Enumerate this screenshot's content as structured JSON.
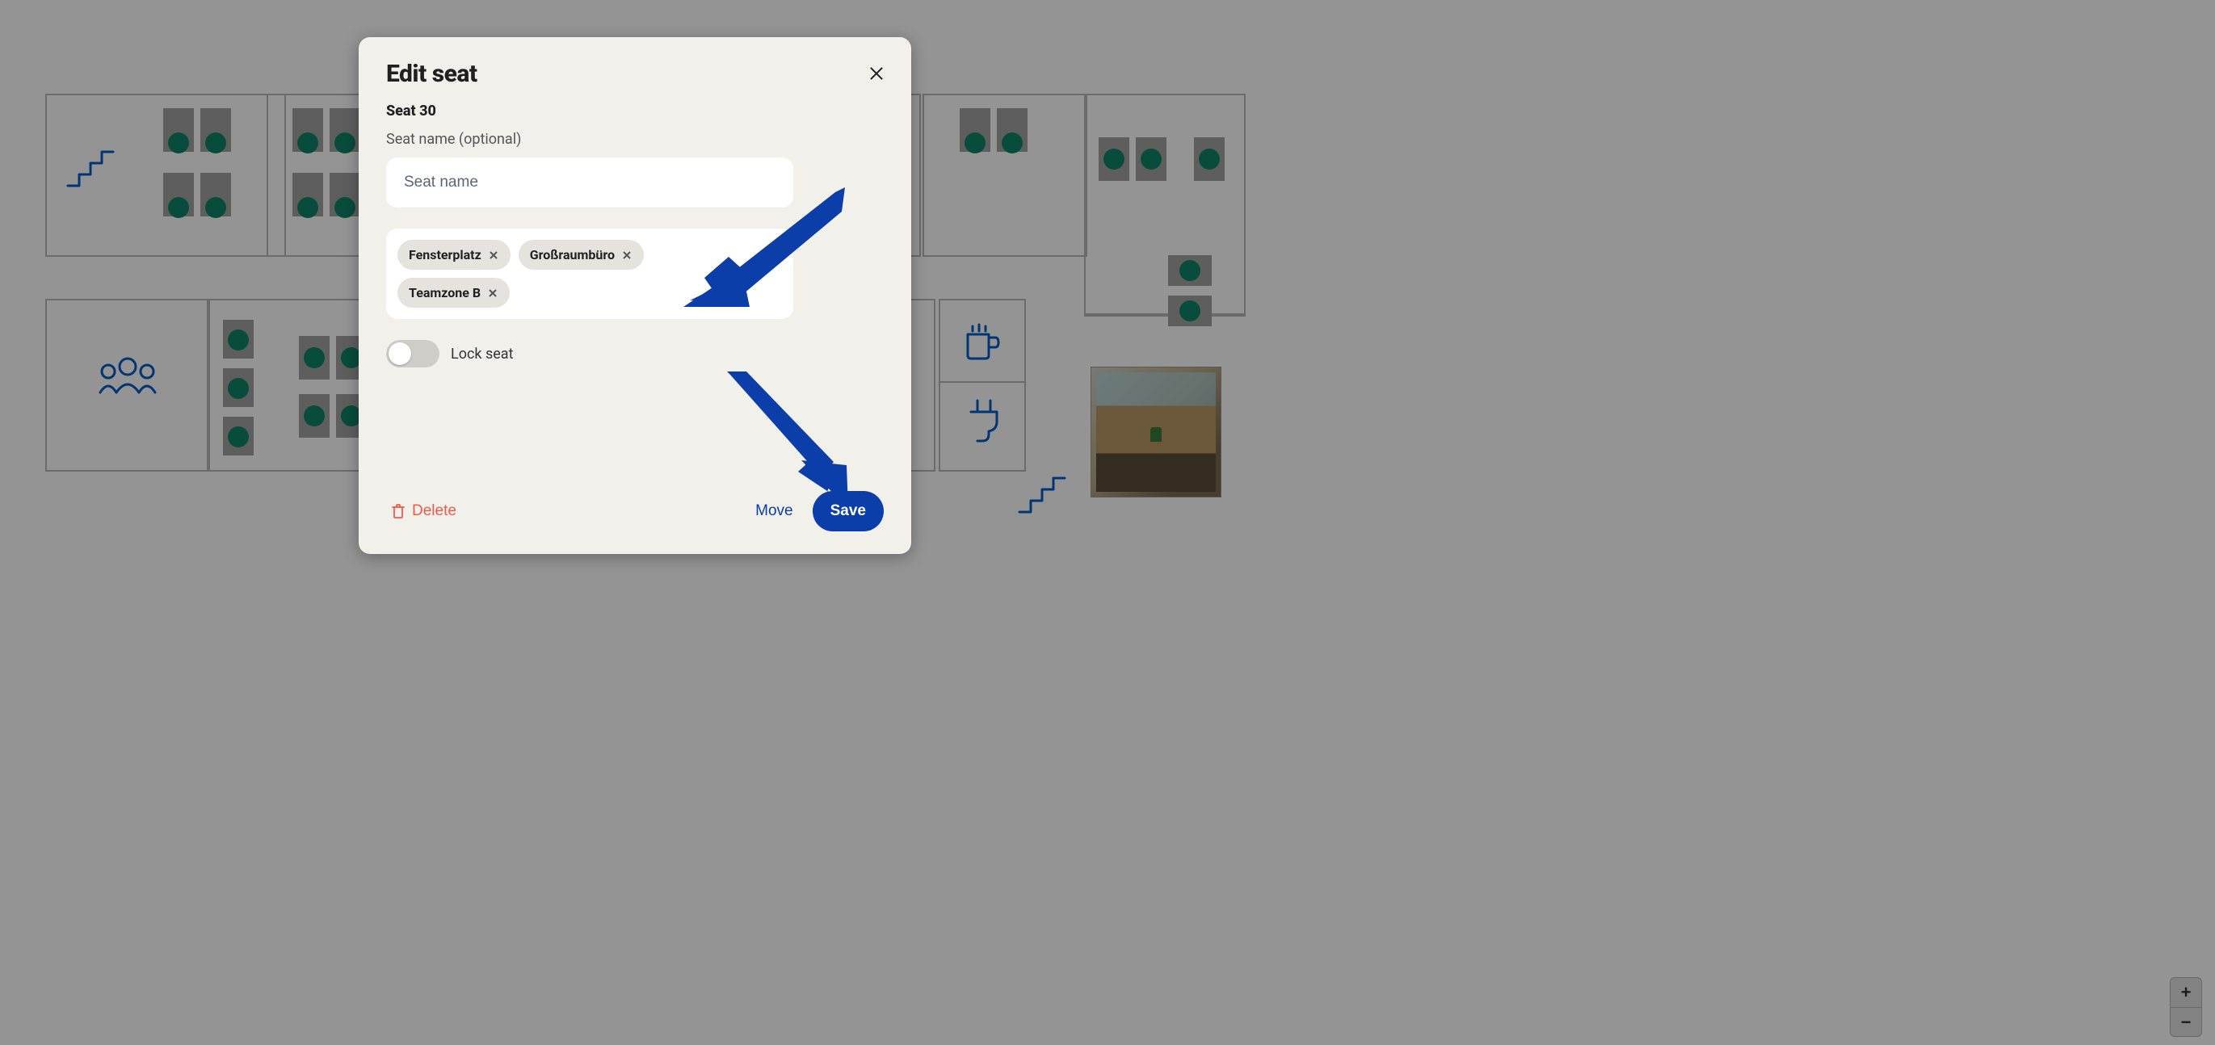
{
  "dialog": {
    "title": "Edit seat",
    "seat_id_label": "Seat 30",
    "seat_name_label": "Seat name (optional)",
    "seat_name_placeholder": "Seat name",
    "seat_name_value": "",
    "tags": [
      {
        "label": "Fensterplatz"
      },
      {
        "label": "Großraumbüro"
      },
      {
        "label": "Teamzone B"
      }
    ],
    "lock_label": "Lock seat",
    "lock_value": false,
    "actions": {
      "delete": "Delete",
      "move": "Move",
      "save": "Save"
    }
  },
  "zoom": {
    "in_label": "+",
    "out_label": "−"
  }
}
